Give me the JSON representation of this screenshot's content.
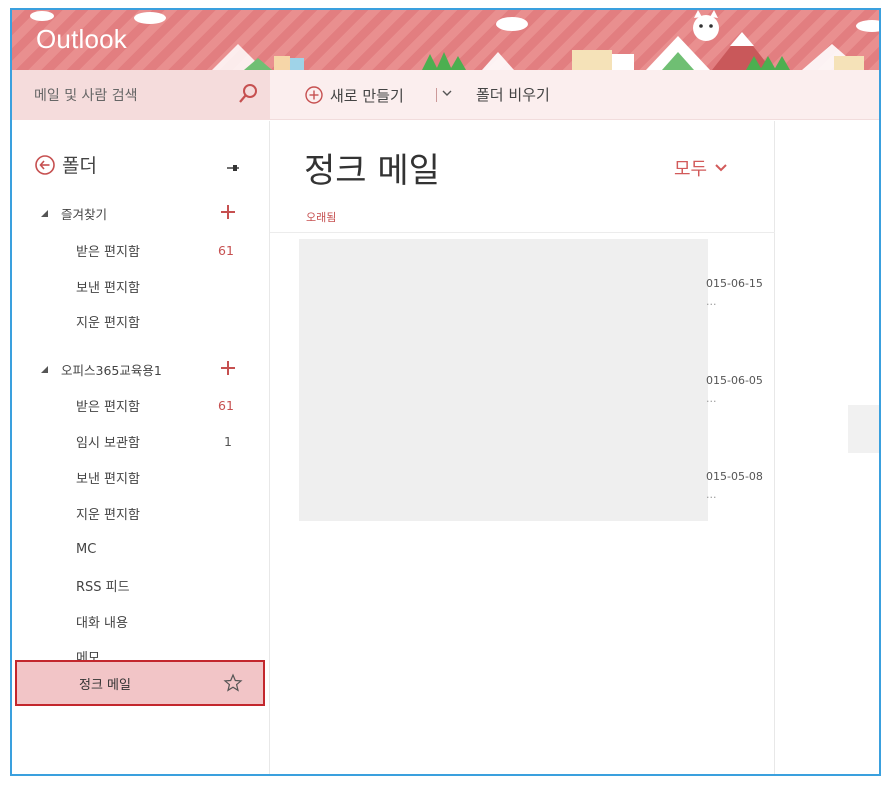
{
  "header": {
    "brand": "Outlook",
    "colors": {
      "banner": "#e98f8f",
      "accent": "#c65050",
      "selected_bg": "#f2c5c7",
      "selected_border": "#c3272d"
    }
  },
  "toolbar": {
    "search_placeholder": "메일 및 사람 검색",
    "search_icon": "search-icon",
    "new_label": "새로 만들기",
    "empty_folder_label": "폴더 비우기"
  },
  "nav": {
    "folders_title": "폴더",
    "favorites": {
      "label": "즐겨찾기",
      "items": [
        {
          "label": "받은 편지함",
          "count": "61"
        },
        {
          "label": "보낸 편지함",
          "count": ""
        },
        {
          "label": "지운 편지함",
          "count": ""
        }
      ]
    },
    "account": {
      "label": "오피스365교육용1",
      "items": [
        {
          "label": "받은 편지함",
          "count": "61"
        },
        {
          "label": "임시 보관함",
          "count": "1"
        },
        {
          "label": "보낸 편지함",
          "count": ""
        },
        {
          "label": "지운 편지함",
          "count": ""
        },
        {
          "label": "MC",
          "count": ""
        },
        {
          "label": "RSS 피드",
          "count": ""
        },
        {
          "label": "대화 내용",
          "count": ""
        },
        {
          "label": "메모",
          "count": ""
        }
      ]
    },
    "selected": {
      "label": "정크 메일"
    }
  },
  "list": {
    "title": "정크 메일",
    "filter_label": "모두",
    "sort_label": "오래됨",
    "messages": [
      {
        "date": "015-06-15",
        "preview": "..."
      },
      {
        "date": "015-06-05",
        "preview": "..."
      },
      {
        "date": "015-05-08",
        "preview": "..."
      }
    ]
  }
}
